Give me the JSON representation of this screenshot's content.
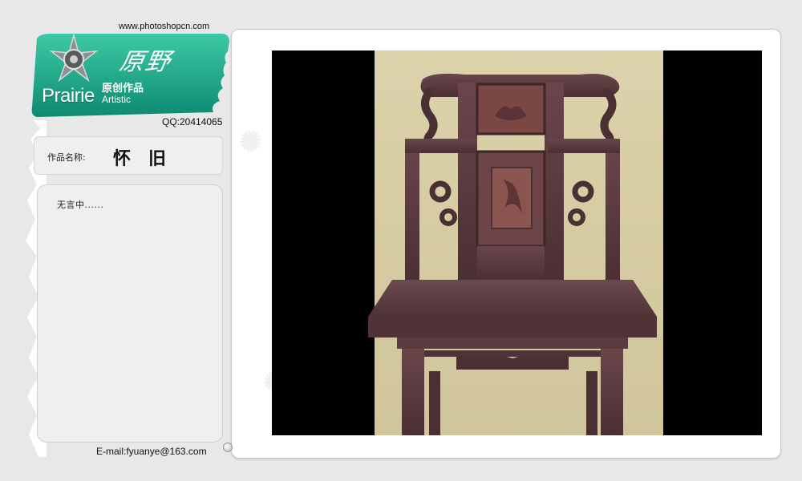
{
  "header": {
    "website": "www.photoshopcn.com",
    "brand_en": "Prairie",
    "brand_sub": "Artistic",
    "brand_cn_big": "原野",
    "brand_cn_small": "原创作品",
    "qq": "QQ:20414065"
  },
  "work": {
    "title_label": "作品名称:",
    "title": "怀旧",
    "description": "无言中......"
  },
  "footer": {
    "email": "E-mail:fyuanye@163.com"
  },
  "artwork": {
    "subject": "chair-image",
    "colors": {
      "background": "#d8cfa8",
      "wood": "#5a3a3e",
      "wood_dark": "#3e2628",
      "panel": "#7a4a42"
    }
  },
  "colors": {
    "accent": "#1aa88a",
    "page_bg": "#e8e8e8"
  }
}
